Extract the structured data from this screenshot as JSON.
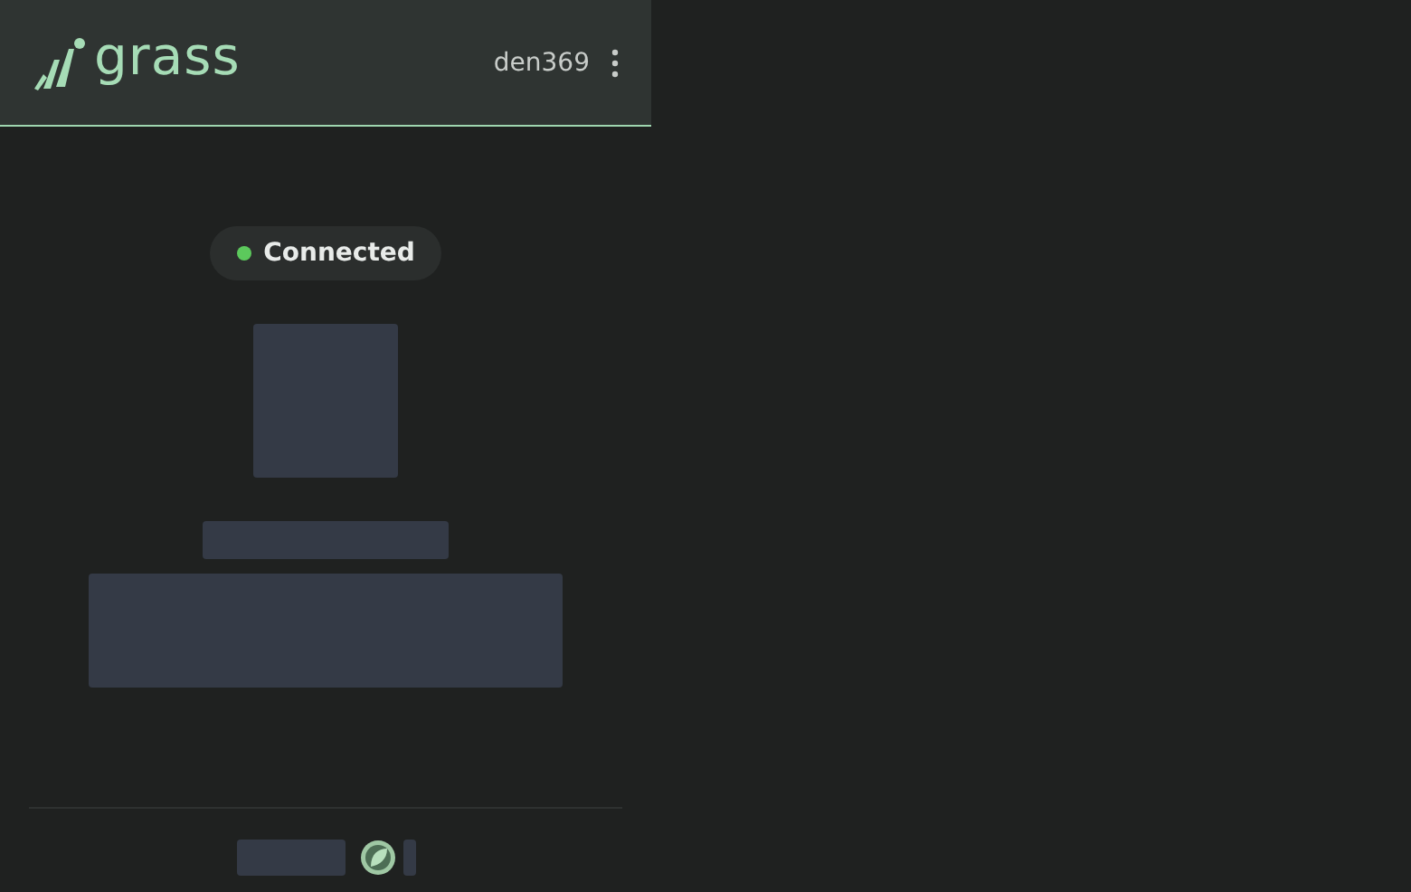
{
  "header": {
    "logo": "grass",
    "username": "den369"
  },
  "status": {
    "label": "Connected",
    "connected": true
  }
}
